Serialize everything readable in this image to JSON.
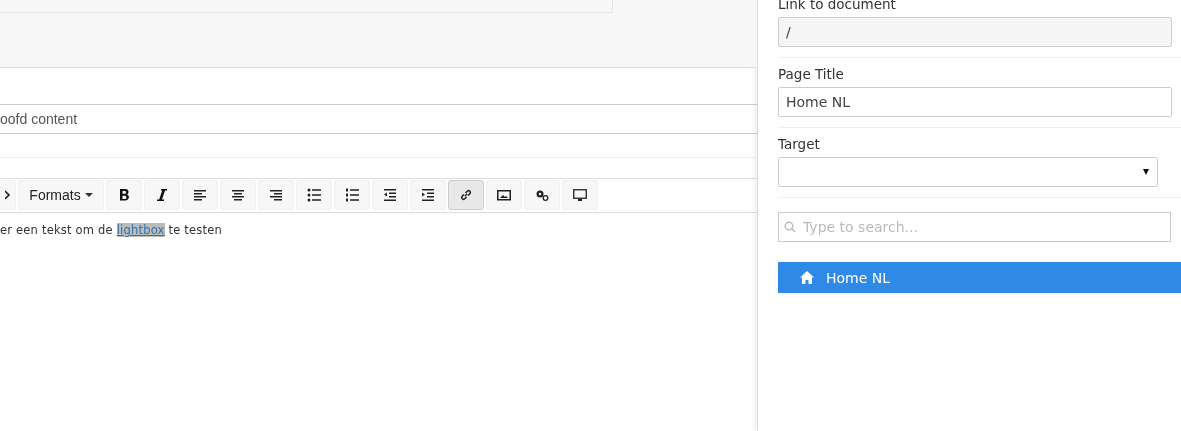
{
  "editor": {
    "title_field": {
      "value": "oofd content"
    },
    "toolbar": [
      {
        "kind": "code",
        "selected": false
      },
      {
        "kind": "formats",
        "label": "Formats",
        "selected": false
      },
      {
        "kind": "bold",
        "selected": false
      },
      {
        "kind": "italic",
        "selected": false
      },
      {
        "kind": "align-left",
        "selected": false
      },
      {
        "kind": "align-center",
        "selected": false
      },
      {
        "kind": "align-right",
        "selected": false
      },
      {
        "kind": "bullets",
        "selected": false
      },
      {
        "kind": "numbers",
        "selected": false
      },
      {
        "kind": "outdent",
        "selected": false
      },
      {
        "kind": "indent",
        "selected": false
      },
      {
        "kind": "link",
        "selected": true
      },
      {
        "kind": "image",
        "selected": false
      },
      {
        "kind": "gears",
        "selected": false
      },
      {
        "kind": "monitor",
        "selected": false
      }
    ],
    "body": {
      "before": "er een tekst om de",
      "link": "lightbox",
      "after": "te testen"
    }
  },
  "link_panel": {
    "link_label": "Link to document",
    "link_value": "/",
    "title_label": "Page Title",
    "title_value": "Home NL",
    "target_label": "Target",
    "search": {
      "placeholder": "Type to search..."
    },
    "tree": [
      {
        "label": "Home NL",
        "selected": true
      }
    ]
  }
}
